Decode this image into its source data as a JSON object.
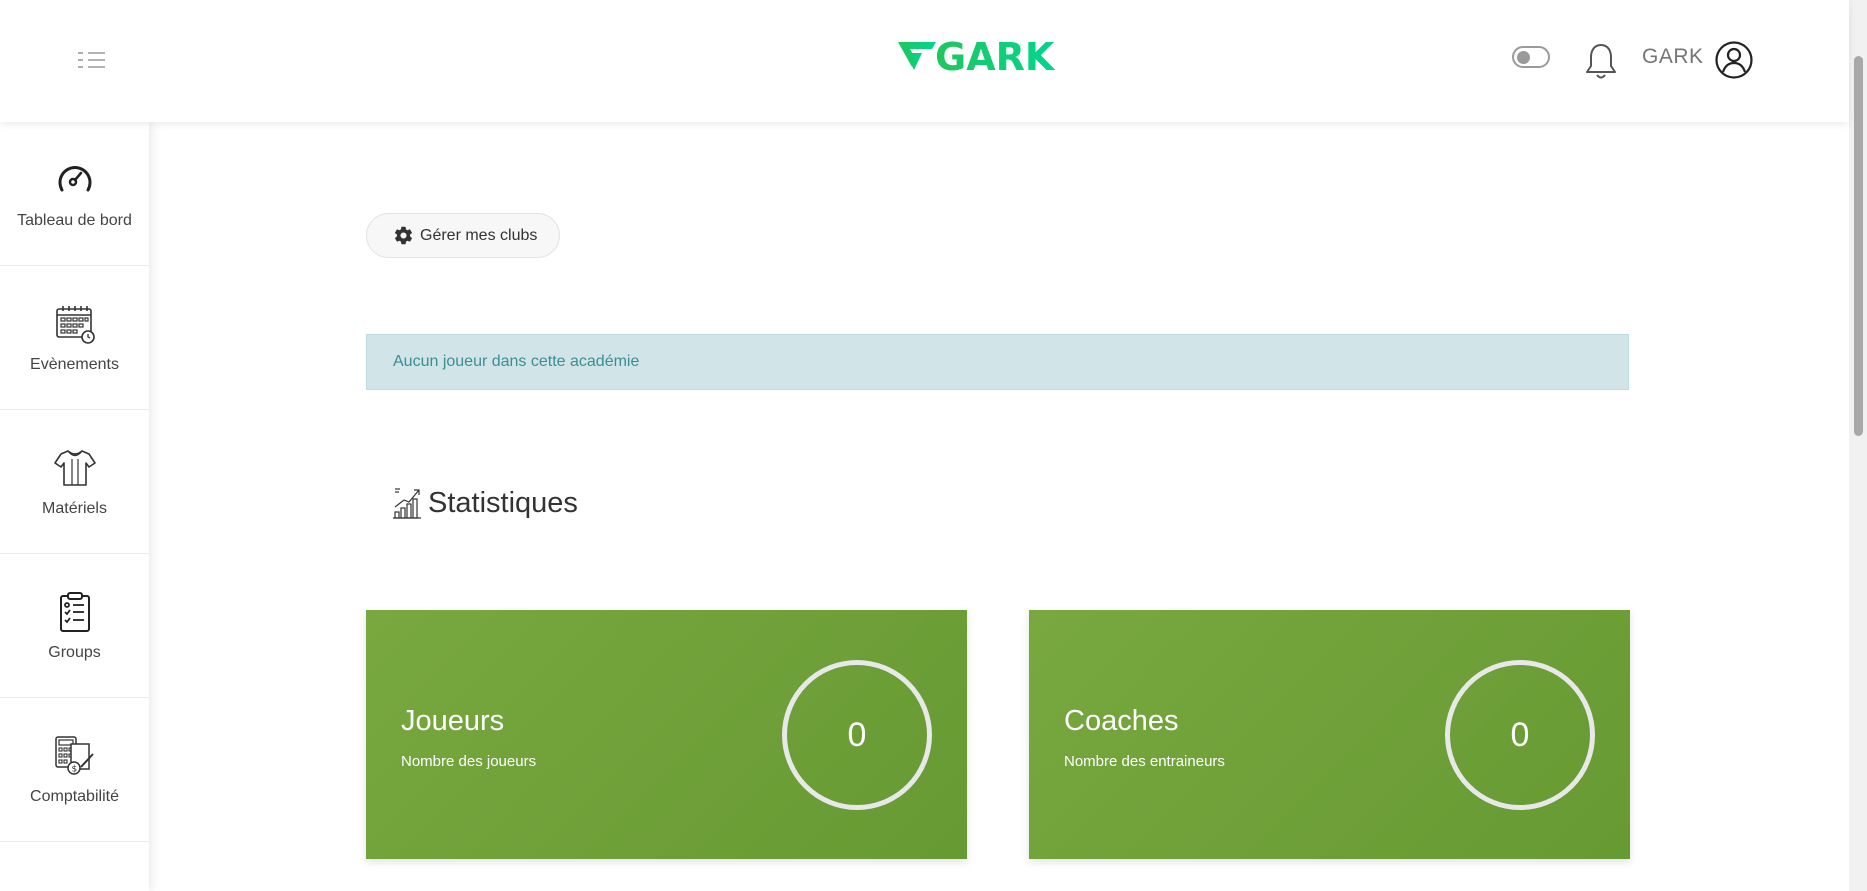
{
  "header": {
    "brand": "GARK",
    "brand_colors": [
      "#22c55e",
      "#00d4a0"
    ],
    "username": "GARK"
  },
  "sidebar": {
    "items": [
      {
        "label": "Tableau de bord",
        "icon": "speedometer-icon"
      },
      {
        "label": "Evènements",
        "icon": "calendar-icon"
      },
      {
        "label": "Matériels",
        "icon": "jersey-icon"
      },
      {
        "label": "Groups",
        "icon": "clipboard-list-icon"
      },
      {
        "label": "Comptabilité",
        "icon": "accounting-icon"
      }
    ]
  },
  "main": {
    "manage_button": "Gérer mes clubs",
    "alert_text": "Aucun joueur dans cette académie",
    "stats_title": "Statistiques",
    "cards": [
      {
        "title": "Joueurs",
        "subtitle": "Nombre des joueurs",
        "value": "0"
      },
      {
        "title": "Coaches",
        "subtitle": "Nombre des entraineurs",
        "value": "0"
      }
    ],
    "card_color": "#72a43c"
  }
}
